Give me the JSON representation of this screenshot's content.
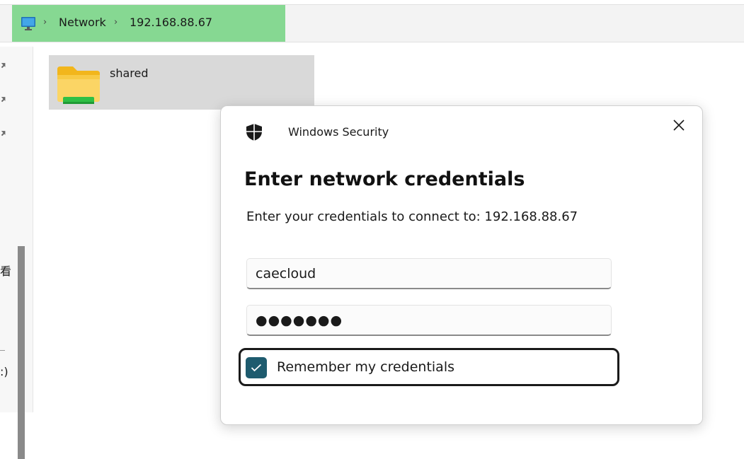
{
  "address_bar": {
    "crumbs": [
      "Network",
      "192.168.88.67"
    ],
    "separator": "›"
  },
  "nav_pane": {
    "partial_text_1": "看",
    "partial_text_2": ":)"
  },
  "files": [
    {
      "name": "shared",
      "icon": "network-share-folder-icon"
    }
  ],
  "dialog": {
    "app_title": "Windows Security",
    "heading": "Enter network credentials",
    "subtext": "Enter your credentials to connect to: 192.168.88.67",
    "username_value": "caecloud",
    "password_value": "●●●●●●●",
    "remember_label": "Remember my credentials",
    "remember_checked": true,
    "accent_color": "#1e5b6e"
  },
  "colors": {
    "breadcrumb_highlight": "#86d892",
    "selected_item": "#d9d9d9"
  }
}
